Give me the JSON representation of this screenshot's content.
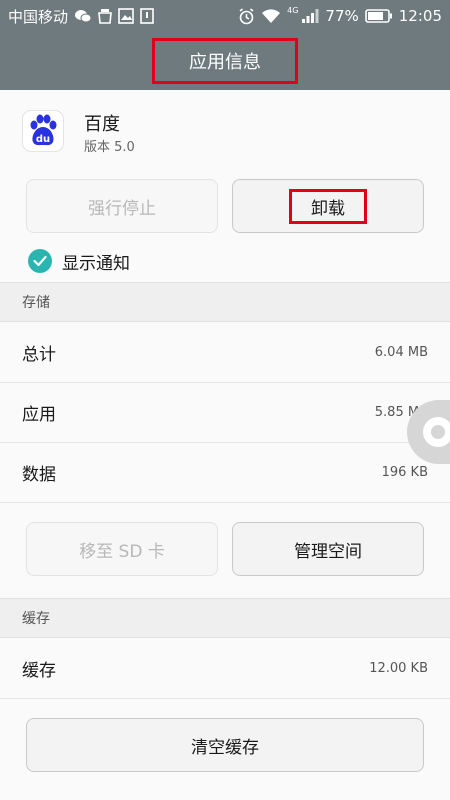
{
  "status_bar": {
    "carrier": "中国移动",
    "network_label": "4G",
    "battery": "77%",
    "time": "12:05"
  },
  "header": {
    "title": "应用信息"
  },
  "app": {
    "name": "百度",
    "version": "版本 5.0",
    "icon_text": "du"
  },
  "buttons": {
    "force_stop": "强行停止",
    "uninstall": "卸载",
    "move_to_sd": "移至 SD 卡",
    "manage_space": "管理空间",
    "clear_cache": "清空缓存"
  },
  "notifications": {
    "label": "显示通知",
    "checked": true
  },
  "storage": {
    "section_label": "存储",
    "rows": [
      {
        "label": "总计",
        "value": "6.04 MB"
      },
      {
        "label": "应用",
        "value": "5.85 MB"
      },
      {
        "label": "数据",
        "value": "196 KB"
      }
    ]
  },
  "cache": {
    "section_label": "缓存",
    "rows": [
      {
        "label": "缓存",
        "value": "12.00 KB"
      }
    ]
  },
  "colors": {
    "header_bg": "#6e7a7d",
    "highlight_red": "#e0001a",
    "check_teal": "#2bb5b0",
    "baidu_blue": "#2932e1"
  }
}
